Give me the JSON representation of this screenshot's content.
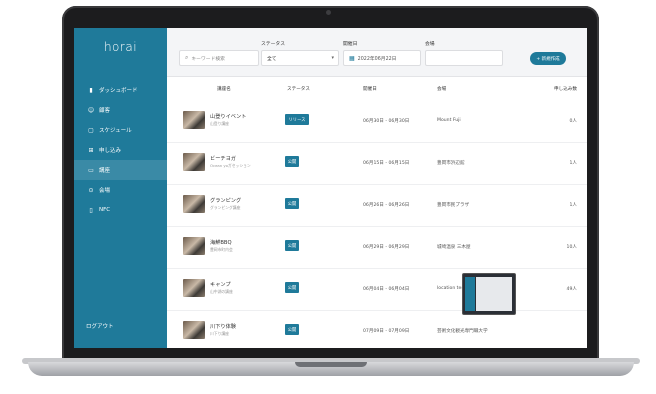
{
  "app": {
    "logo": "horai",
    "nav": [
      {
        "label": "ダッシュボード",
        "icon": "bar-chart-icon"
      },
      {
        "label": "顧客",
        "icon": "person-icon"
      },
      {
        "label": "スケジュール",
        "icon": "calendar-icon"
      },
      {
        "label": "申し込み",
        "icon": "grid-icon"
      },
      {
        "label": "講座",
        "icon": "card-icon"
      },
      {
        "label": "会場",
        "icon": "pin-icon"
      },
      {
        "label": "NFC",
        "icon": "nfc-icon"
      }
    ],
    "logout": "ログアウト"
  },
  "filters": {
    "status_label": "ステータス",
    "date_label": "開催日",
    "venue_label": "会場",
    "keyword_placeholder": "キーワード検索",
    "status_value": "全て",
    "date_value": "2022年06月22日",
    "new_button": "+ 新規作成"
  },
  "table": {
    "headers": [
      "講座名",
      "ステータス",
      "開催日",
      "会場",
      "申し込み数"
    ],
    "rows": [
      {
        "name": "山登りイベント",
        "sub": "山登り講座",
        "status": "リリース",
        "date": "06月30日 - 06月30日",
        "venue": "Mount Fuji",
        "count": "0人"
      },
      {
        "name": "ビーチヨガ",
        "sub": "Ocean yoガセッション",
        "status": "公開",
        "date": "06月15日 - 06月15日",
        "venue": "豊岡市浜辺館",
        "count": "1人"
      },
      {
        "name": "グランピング",
        "sub": "グランピング講座",
        "status": "公開",
        "date": "06月26日 - 06月26日",
        "venue": "豊岡市民プラザ",
        "count": "1人"
      },
      {
        "name": "海鮮BBQ",
        "sub": "豊岡市町内会",
        "status": "公開",
        "date": "06月29日 - 06月29日",
        "venue": "城崎温泉 三木屋",
        "count": "10人"
      },
      {
        "name": "キャンプ",
        "sub": "山中湖の講座",
        "status": "公開",
        "date": "06月04日 - 06月04日",
        "venue": "location test 1",
        "count": "49人"
      },
      {
        "name": "川下り体験",
        "sub": "川下り講座",
        "status": "公開",
        "date": "07月09日 - 07月09日",
        "venue": "芸術文化観光専門職大学",
        "count": ""
      }
    ]
  }
}
